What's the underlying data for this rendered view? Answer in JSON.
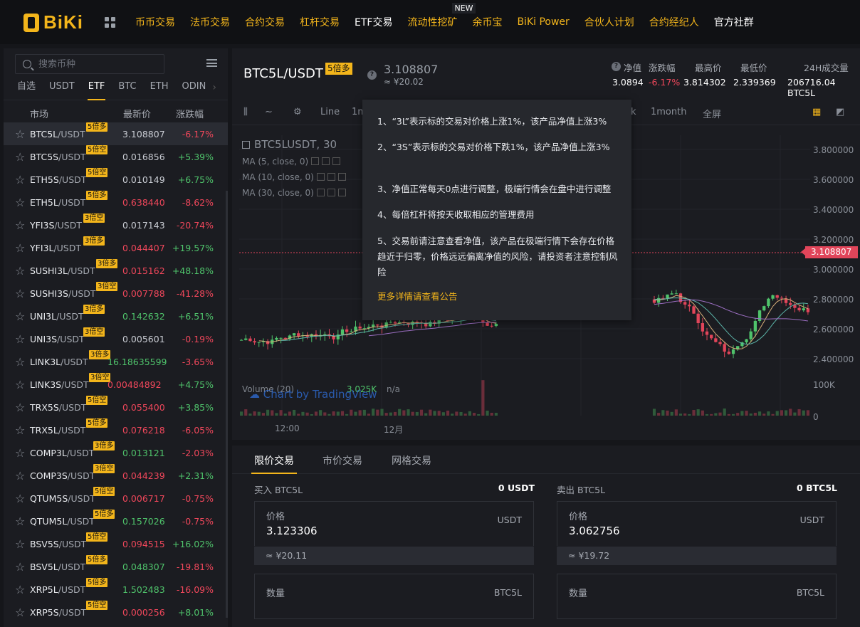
{
  "brand": {
    "name": "BiKi"
  },
  "nav": [
    {
      "label": "币币交易",
      "color": "gold"
    },
    {
      "label": "法币交易",
      "color": "gold"
    },
    {
      "label": "合约交易",
      "color": "gold"
    },
    {
      "label": "杠杆交易",
      "color": "gold"
    },
    {
      "label": "ETF交易",
      "color": "white"
    },
    {
      "label": "流动性挖矿",
      "color": "gold",
      "badge": "NEW"
    },
    {
      "label": "余币宝",
      "color": "gold"
    },
    {
      "label": "BiKi Power",
      "color": "gold"
    },
    {
      "label": "合伙人计划",
      "color": "gold"
    },
    {
      "label": "合约经纪人",
      "color": "gold"
    },
    {
      "label": "官方社群",
      "color": "white"
    }
  ],
  "sidebar": {
    "search_placeholder": "搜索币种",
    "tabs": [
      "自选",
      "USDT",
      "ETF",
      "BTC",
      "ETH",
      "ODIN"
    ],
    "active_tab": "ETF",
    "headers": {
      "market": "市场",
      "price": "最新价",
      "change": "涨跌幅"
    },
    "rows": [
      {
        "base": "BTC5L",
        "quote": "/USDT",
        "lev": "5倍多",
        "price": "3.108807",
        "price_dir": "neutral",
        "change": "-6.17%",
        "dir": "down"
      },
      {
        "base": "BTC5S",
        "quote": "/USDT",
        "lev": "5倍空",
        "price": "0.016856",
        "price_dir": "neutral",
        "change": "+5.39%",
        "dir": "up"
      },
      {
        "base": "ETH5S",
        "quote": "/USDT",
        "lev": "5倍空",
        "price": "0.010149",
        "price_dir": "neutral",
        "change": "+6.75%",
        "dir": "up"
      },
      {
        "base": "ETH5L",
        "quote": "/USDT",
        "lev": "5倍多",
        "price": "0.638440",
        "price_dir": "down",
        "change": "-8.62%",
        "dir": "down"
      },
      {
        "base": "YFI3S",
        "quote": "/USDT",
        "lev": "3倍空",
        "price": "0.017143",
        "price_dir": "neutral",
        "change": "-20.74%",
        "dir": "down"
      },
      {
        "base": "YFI3L",
        "quote": "/USDT",
        "lev": "3倍多",
        "price": "0.044407",
        "price_dir": "down",
        "change": "+19.57%",
        "dir": "up"
      },
      {
        "base": "SUSHI3L",
        "quote": "/USDT",
        "lev": "3倍多",
        "price": "0.015162",
        "price_dir": "down",
        "change": "+48.18%",
        "dir": "up"
      },
      {
        "base": "SUSHI3S",
        "quote": "/USDT",
        "lev": "3倍空",
        "price": "0.007788",
        "price_dir": "down",
        "change": "-41.28%",
        "dir": "down"
      },
      {
        "base": "UNI3L",
        "quote": "/USDT",
        "lev": "3倍多",
        "price": "0.142632",
        "price_dir": "up",
        "change": "+6.51%",
        "dir": "up"
      },
      {
        "base": "UNI3S",
        "quote": "/USDT",
        "lev": "3倍空",
        "price": "0.005601",
        "price_dir": "neutral",
        "change": "-0.19%",
        "dir": "down"
      },
      {
        "base": "LINK3L",
        "quote": "/USDT",
        "lev": "3倍多",
        "price": "16.18635599",
        "price_dir": "up",
        "change": "-3.65%",
        "dir": "down"
      },
      {
        "base": "LINK3S",
        "quote": "/USDT",
        "lev": "3倍空",
        "price": "0.00484892",
        "price_dir": "down",
        "change": "+4.75%",
        "dir": "up"
      },
      {
        "base": "TRX5S",
        "quote": "/USDT",
        "lev": "5倍空",
        "price": "0.055400",
        "price_dir": "down",
        "change": "+3.85%",
        "dir": "up"
      },
      {
        "base": "TRX5L",
        "quote": "/USDT",
        "lev": "5倍多",
        "price": "0.076218",
        "price_dir": "down",
        "change": "-6.05%",
        "dir": "down"
      },
      {
        "base": "COMP3L",
        "quote": "/USDT",
        "lev": "3倍多",
        "price": "0.013121",
        "price_dir": "up",
        "change": "-2.03%",
        "dir": "down"
      },
      {
        "base": "COMP3S",
        "quote": "/USDT",
        "lev": "3倍空",
        "price": "0.044239",
        "price_dir": "down",
        "change": "+2.31%",
        "dir": "up"
      },
      {
        "base": "QTUM5S",
        "quote": "/USDT",
        "lev": "5倍空",
        "price": "0.006717",
        "price_dir": "down",
        "change": "-0.75%",
        "dir": "down"
      },
      {
        "base": "QTUM5L",
        "quote": "/USDT",
        "lev": "5倍多",
        "price": "0.157026",
        "price_dir": "up",
        "change": "-0.75%",
        "dir": "down"
      },
      {
        "base": "BSV5S",
        "quote": "/USDT",
        "lev": "5倍空",
        "price": "0.094515",
        "price_dir": "down",
        "change": "+16.02%",
        "dir": "up"
      },
      {
        "base": "BSV5L",
        "quote": "/USDT",
        "lev": "5倍多",
        "price": "0.048307",
        "price_dir": "up",
        "change": "-19.81%",
        "dir": "down"
      },
      {
        "base": "XRP5L",
        "quote": "/USDT",
        "lev": "5倍多",
        "price": "1.502483",
        "price_dir": "up",
        "change": "-16.09%",
        "dir": "down"
      },
      {
        "base": "XRP5S",
        "quote": "/USDT",
        "lev": "5倍空",
        "price": "0.000256",
        "price_dir": "down",
        "change": "+8.01%",
        "dir": "up"
      }
    ]
  },
  "header": {
    "symbol": "BTC5L/USDT",
    "lev": "5倍多",
    "price": "3.108807",
    "cny": "≈ ¥20.02",
    "stats": [
      {
        "label": "净值",
        "value": "3.0894",
        "dir": "white"
      },
      {
        "label": "涨跌幅",
        "value": "-6.17%",
        "dir": "down"
      },
      {
        "label": "最高价",
        "value": "3.814302",
        "dir": "white"
      },
      {
        "label": "最低价",
        "value": "2.339369",
        "dir": "white"
      },
      {
        "label": "24H成交量",
        "value": "206716.04 BTC5L",
        "dir": "white"
      }
    ]
  },
  "toolbar": {
    "line": "Line",
    "partial": "1m",
    "k": "k",
    "month": "1month",
    "fullscreen": "全屏"
  },
  "chart_legend": {
    "title": "BTC5LUSDT, 30",
    "ma": [
      "MA (5, close, 0)",
      "MA (10, close, 0)",
      "MA (30, close, 0)"
    ],
    "volume": "Volume (20)",
    "volume_val": "3.025K",
    "volume_na": "n/a",
    "tv": "Chart by TradingView",
    "time_ticks": [
      "12:00",
      "12月"
    ]
  },
  "chart_data": {
    "type": "candlestick",
    "y_ticks": [
      "3.800000",
      "3.600000",
      "3.400000",
      "3.200000",
      "3.000000",
      "2.800000",
      "2.600000",
      "2.400000"
    ],
    "volume_ticks": [
      "100K",
      "0"
    ],
    "last_price": "3.108807",
    "ylim": [
      2.3,
      3.9
    ]
  },
  "tooltip": {
    "items": [
      "1、“3L”表示标的交易对价格上涨1%，该产品净值上涨3%",
      "2、“3S”表示标的交易对价格下跌1%，该产品净值上涨3%",
      "3、净值正常每天0点进行调整，极端行情会在盘中进行调整",
      "4、每倍杠杆将按天收取相应的管理费用",
      "5、交易前请注意查看净值，该产品在极端行情下会存在价格趋近于归零，价格远远偏离净值的风险，请投资者注意控制风险"
    ],
    "more": "更多详情请查看公告"
  },
  "trade": {
    "tabs": [
      "限价交易",
      "市价交易",
      "网格交易"
    ],
    "buy": {
      "title": "买入 BTC5L",
      "balance": "0 USDT",
      "price_label": "价格",
      "price": "3.123306",
      "unit": "USDT",
      "approx": "≈ ¥20.11",
      "qty_label": "数量",
      "qty_unit": "BTC5L"
    },
    "sell": {
      "title": "卖出 BTC5L",
      "balance": "0 BTC5L",
      "price_label": "价格",
      "price": "3.062756",
      "unit": "USDT",
      "approx": "≈ ¥19.72",
      "qty_label": "数量",
      "qty_unit": "BTC5L"
    }
  }
}
